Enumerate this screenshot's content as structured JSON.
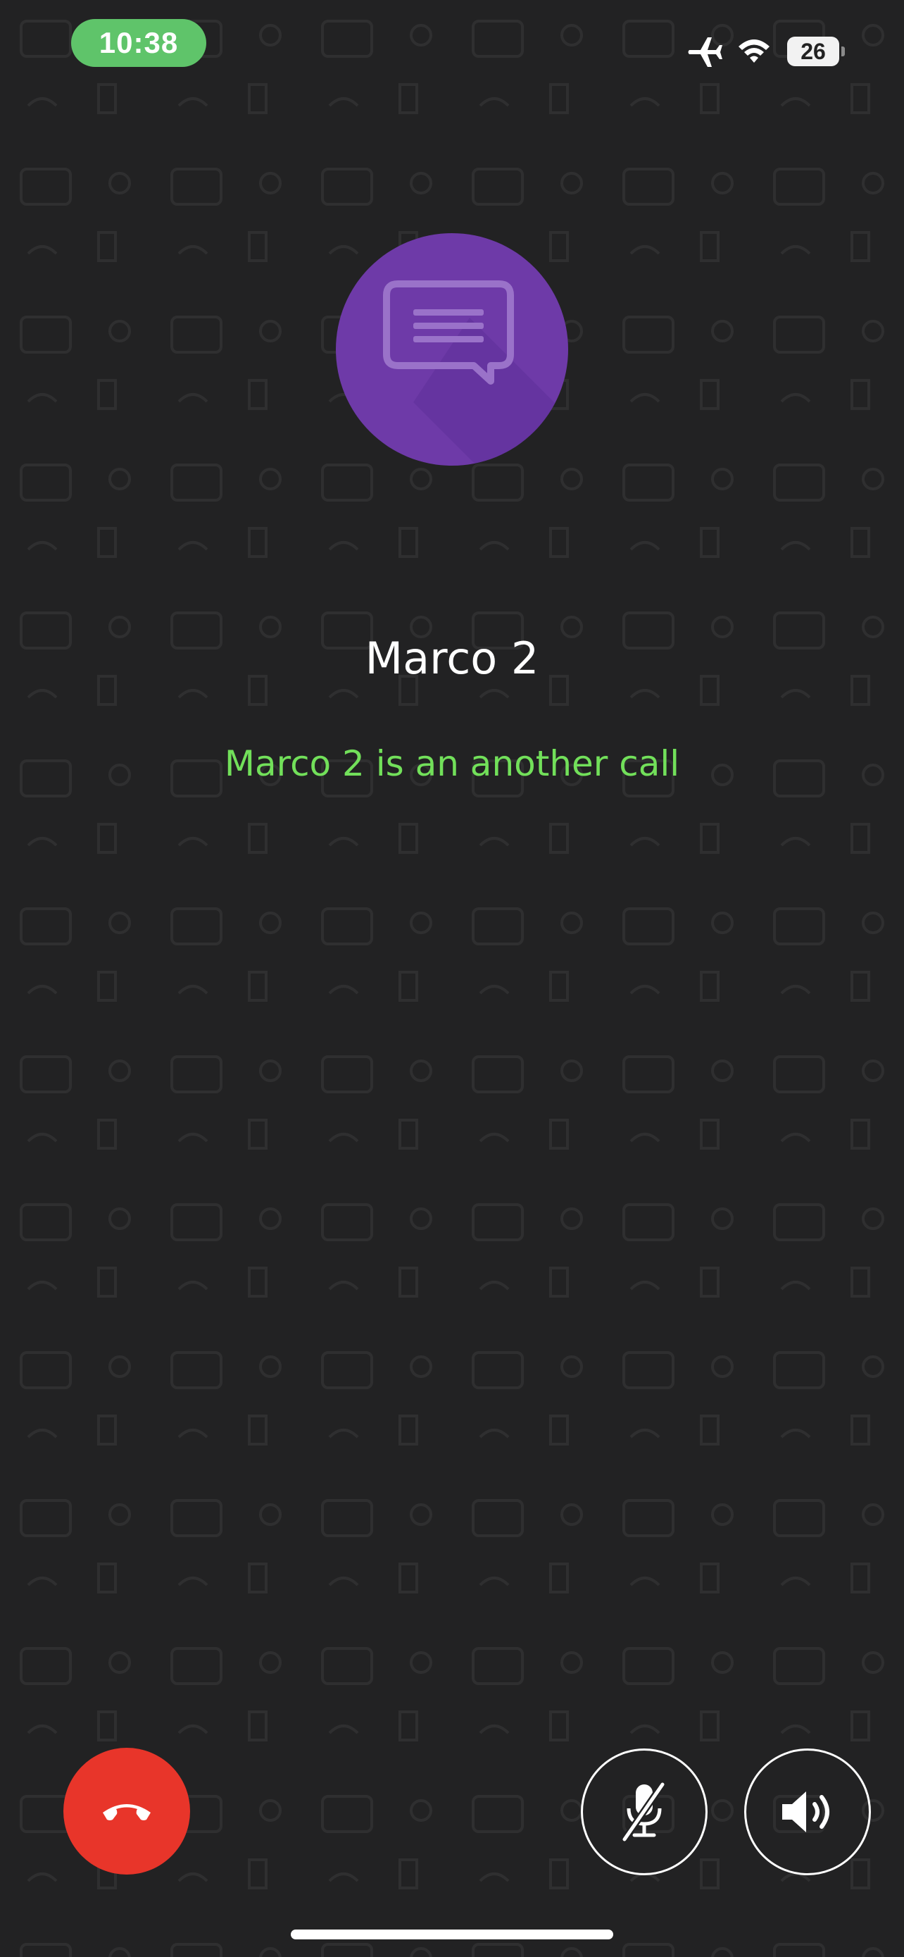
{
  "status_bar": {
    "time": "10:38",
    "battery_level": "26",
    "icons": [
      "airplane-mode-icon",
      "wifi-icon",
      "battery-icon"
    ],
    "time_pill_color": "#5fc46a"
  },
  "caller": {
    "avatar_icon": "chat-bubble-icon",
    "avatar_color": "#6e3aa8",
    "name": "Marco 2",
    "status": "Marco 2 is an another call",
    "status_color": "#72e05a"
  },
  "controls": {
    "hangup_icon": "phone-hangup-icon",
    "hangup_color": "#e8352a",
    "mute_icon": "microphone-muted-icon",
    "speaker_icon": "speaker-icon"
  },
  "colors": {
    "background": "#222223"
  }
}
